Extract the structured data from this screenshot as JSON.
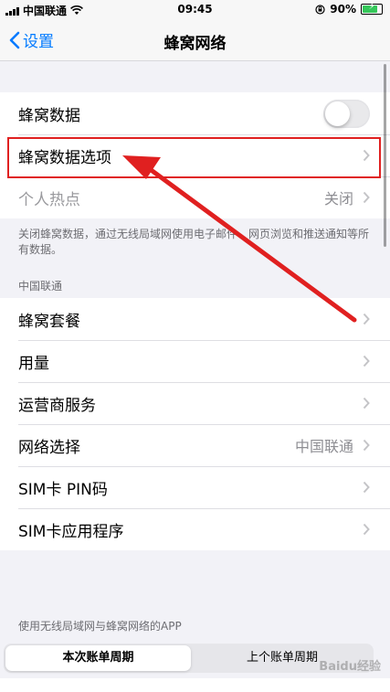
{
  "status_bar": {
    "carrier": "中国联通",
    "time": "09:45",
    "battery": "90%",
    "battery_level": 0.9
  },
  "nav": {
    "back_label": "设置",
    "title": "蜂窝网络"
  },
  "cellular_group": {
    "cellular_data_label": "蜂窝数据",
    "cellular_data_on": false,
    "cellular_options_label": "蜂窝数据选项",
    "hotspot_label": "个人热点",
    "hotspot_value": "关闭"
  },
  "footnote": "关闭蜂窝数据，通过无线局域网使用电子邮件、网页浏览和推送通知等所有数据。",
  "carrier_section": {
    "header": "中国联通",
    "items": [
      {
        "label": "蜂窝套餐",
        "value": ""
      },
      {
        "label": "用量",
        "value": ""
      },
      {
        "label": "运营商服务",
        "value": ""
      },
      {
        "label": "网络选择",
        "value": "中国联通"
      },
      {
        "label": "SIM卡 PIN码",
        "value": ""
      },
      {
        "label": "SIM卡应用程序",
        "value": ""
      }
    ]
  },
  "apps_section": {
    "header": "使用无线局域网与蜂窝网络的APP",
    "segment_current": "本次账单周期",
    "segment_previous": "上个账单周期"
  },
  "watermark": "Baidu经验",
  "colors": {
    "accent": "#007aff",
    "annotation": "#e02020"
  }
}
